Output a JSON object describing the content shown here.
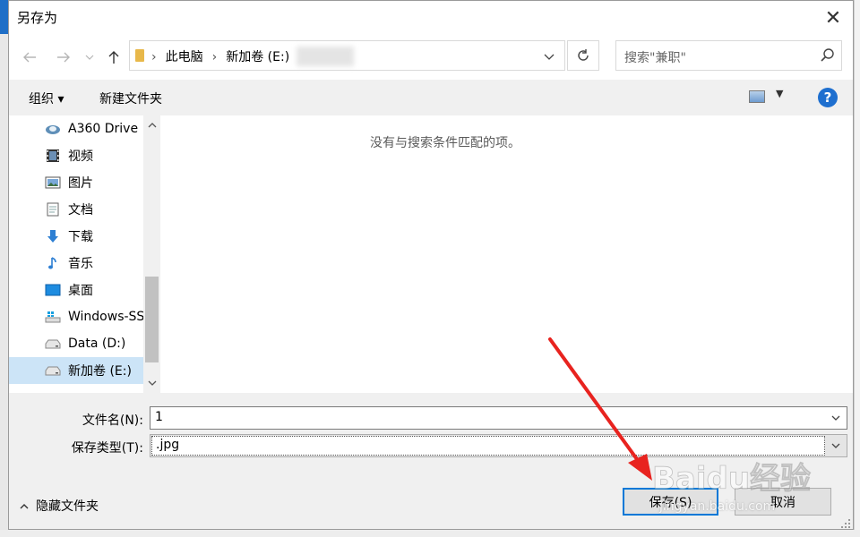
{
  "dialog": {
    "title": "另存为",
    "close_glyph": "✕"
  },
  "nav": {
    "path": [
      "此电脑",
      "新加卷 (E:)"
    ],
    "search_placeholder": "搜索\"兼职\""
  },
  "toolbar": {
    "organize_label": "组织 ▾",
    "new_folder_label": "新建文件夹",
    "help_label": "?"
  },
  "sidebar": {
    "items": [
      {
        "label": "A360 Drive",
        "icon": "cloud-drive-icon"
      },
      {
        "label": "视频",
        "icon": "video-icon"
      },
      {
        "label": "图片",
        "icon": "pictures-icon"
      },
      {
        "label": "文档",
        "icon": "documents-icon"
      },
      {
        "label": "下载",
        "icon": "download-icon"
      },
      {
        "label": "音乐",
        "icon": "music-icon"
      },
      {
        "label": "桌面",
        "icon": "desktop-icon"
      },
      {
        "label": "Windows-SSD",
        "icon": "windows-drive-icon"
      },
      {
        "label": "Data (D:)",
        "icon": "drive-icon"
      },
      {
        "label": "新加卷 (E:)",
        "icon": "drive-icon",
        "selected": true
      }
    ]
  },
  "main": {
    "empty_message": "没有与搜索条件匹配的项。"
  },
  "form": {
    "filename_label": "文件名(N):",
    "filename_value": "1",
    "filetype_label": "保存类型(T):",
    "filetype_value": ".jpg"
  },
  "footer": {
    "hide_folders_label": "隐藏文件夹",
    "save_label": "保存(S)",
    "cancel_label": "取消"
  },
  "watermark": {
    "brand": "Baidu经验",
    "url": "jingyan.baidu.com"
  },
  "colors": {
    "accent": "#0078d7",
    "annotation_arrow": "#e8231f",
    "selection": "#cce4f7"
  }
}
